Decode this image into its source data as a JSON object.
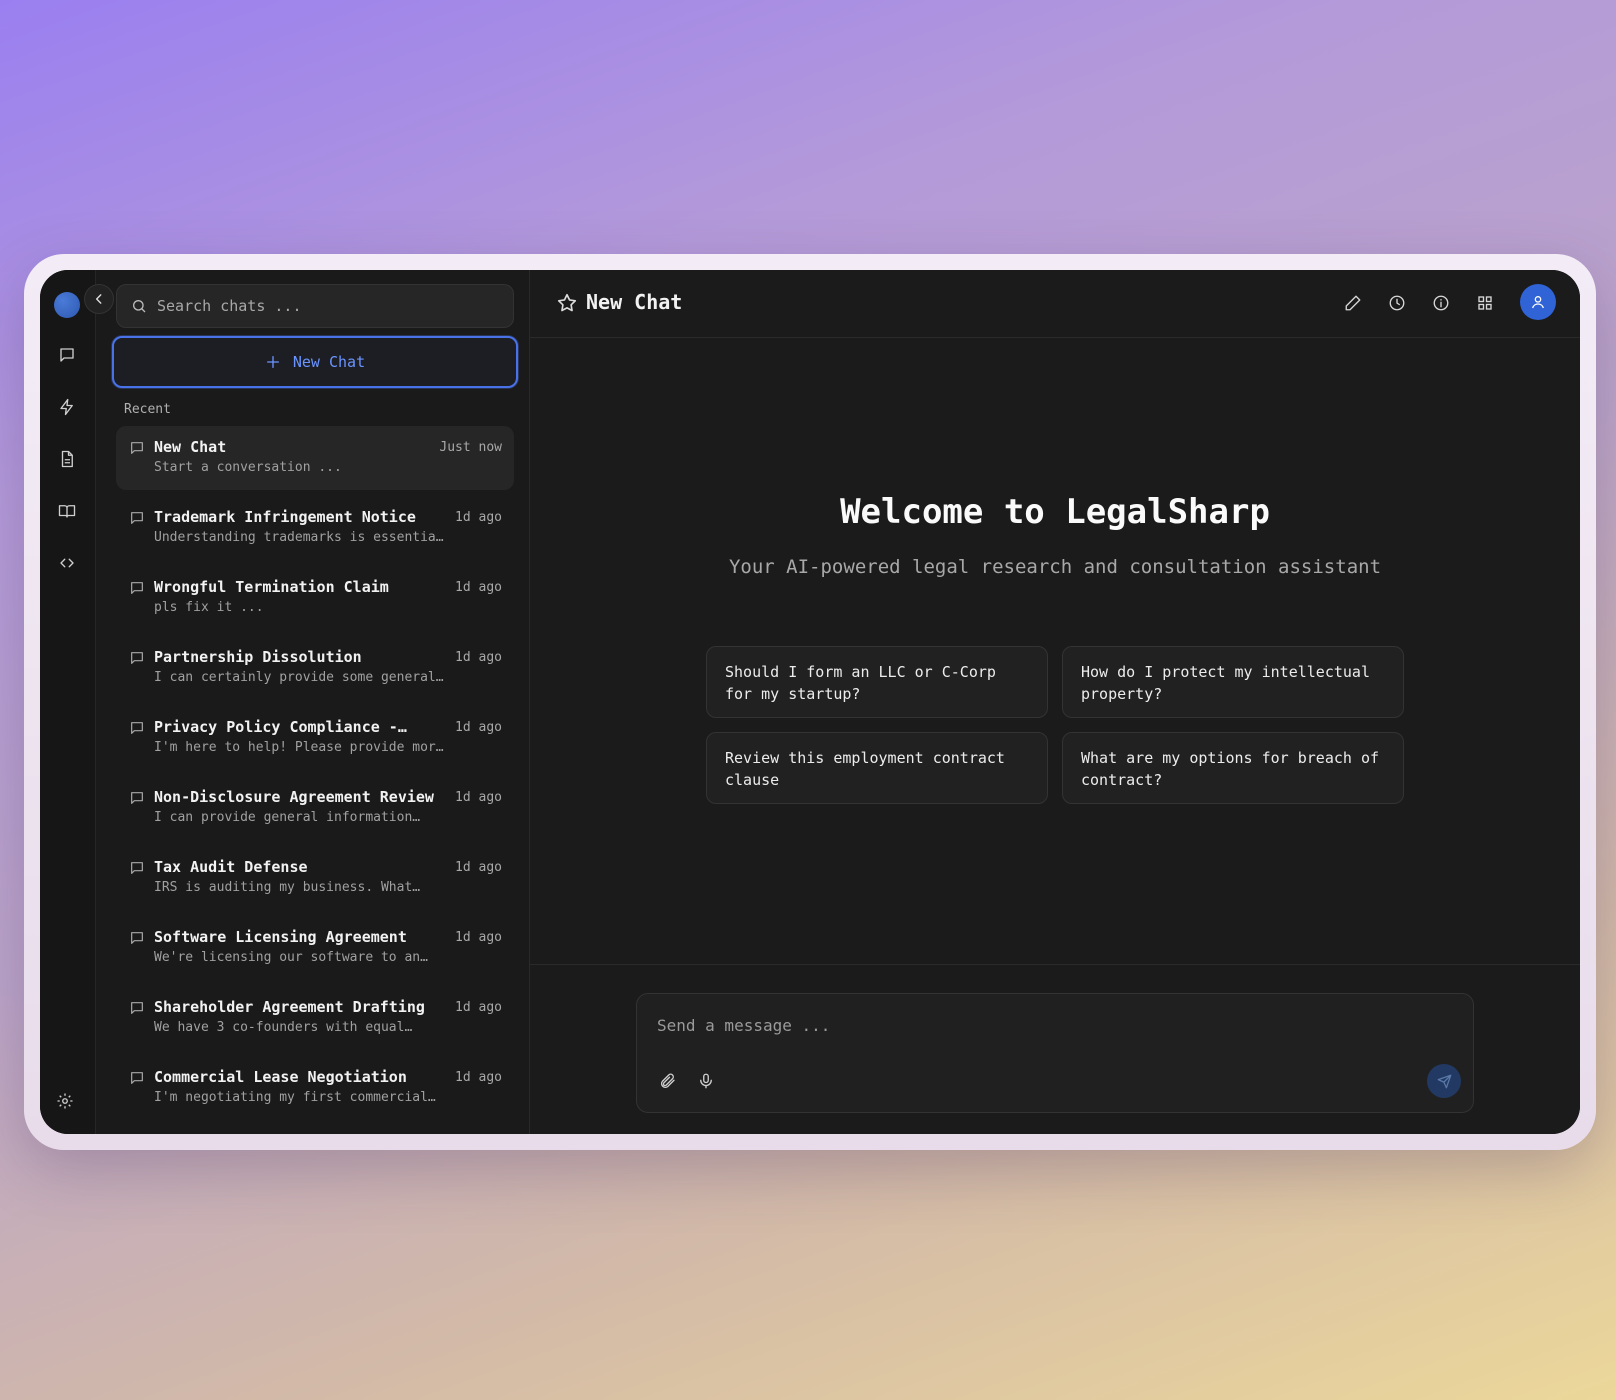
{
  "app": {
    "name": "LegalSharp"
  },
  "rail": {
    "icons": [
      "chat-icon",
      "bolt-icon",
      "document-icon",
      "book-icon",
      "code-icon"
    ],
    "settings_icon": "gear-icon"
  },
  "sidebar": {
    "search_placeholder": "Search chats ...",
    "new_chat_label": "New Chat",
    "recent_label": "Recent",
    "chats": [
      {
        "title": "New Chat",
        "preview": "Start a conversation ...",
        "time": "Just now",
        "active": true
      },
      {
        "title": "Trademark Infringement Notice",
        "preview": "Understanding trademarks is essentia…",
        "time": "1d ago"
      },
      {
        "title": "Wrongful Termination Claim",
        "preview": "pls fix it ...",
        "time": "1d ago"
      },
      {
        "title": "Partnership Dissolution",
        "preview": "I can certainly provide some general…",
        "time": "1d ago"
      },
      {
        "title": "Privacy Policy Compliance -…",
        "preview": "I'm here to help! Please provide mor…",
        "time": "1d ago"
      },
      {
        "title": "Non-Disclosure Agreement Review",
        "preview": "I can provide general information…",
        "time": "1d ago"
      },
      {
        "title": "Tax Audit Defense",
        "preview": "IRS is auditing my business. What…",
        "time": "1d ago"
      },
      {
        "title": "Software Licensing Agreement",
        "preview": "We're licensing our software to an…",
        "time": "1d ago"
      },
      {
        "title": "Shareholder Agreement Drafting",
        "preview": "We have 3 co-founders with equal…",
        "time": "1d ago"
      },
      {
        "title": "Commercial Lease Negotiation",
        "preview": "I'm negotiating my first commercial…",
        "time": "1d ago"
      }
    ]
  },
  "header": {
    "title": "New Chat"
  },
  "main": {
    "welcome": "Welcome to LegalSharp",
    "tagline": "Your AI-powered legal research and consultation assistant",
    "suggestions": [
      "Should I form an LLC or C-Corp for my startup?",
      "How do I protect my intellectual property?",
      "Review this employment contract clause",
      "What are my options for breach of contract?"
    ]
  },
  "composer": {
    "placeholder": "Send a message ..."
  },
  "colors": {
    "accent": "#4a72e8",
    "avatar": "#3063d6",
    "background": "#1b1b1b"
  }
}
